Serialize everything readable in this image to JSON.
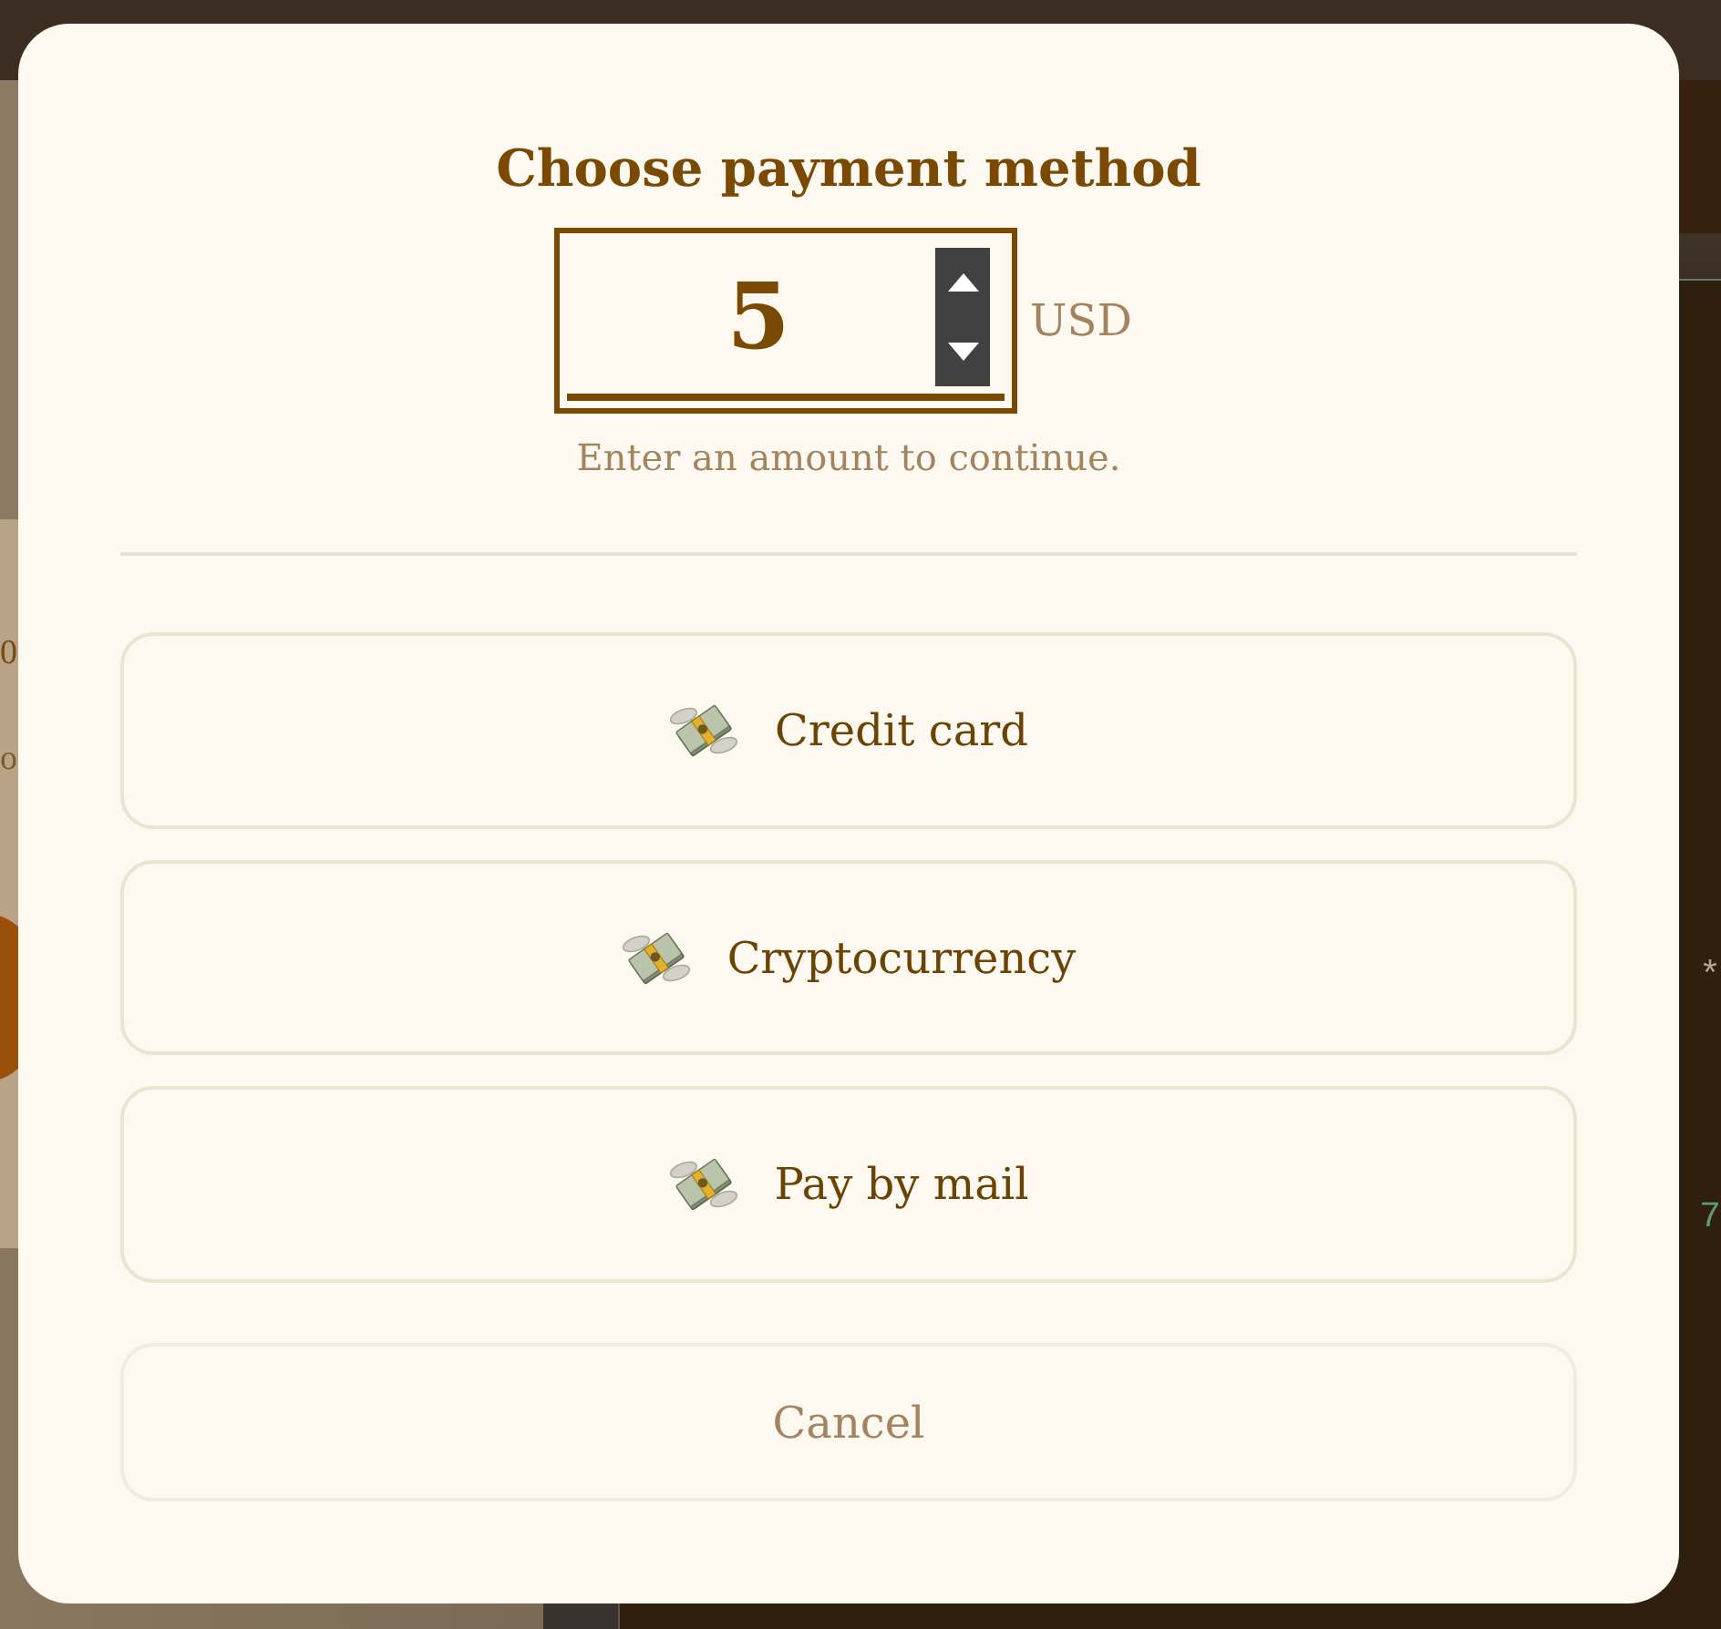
{
  "backdrop": {
    "left_panel": {
      "texts": [
        "0",
        "o"
      ]
    },
    "right_panel": {
      "texts": [
        "*",
        "7"
      ]
    }
  },
  "dialog": {
    "title": "Choose payment method",
    "amount": {
      "value": "5",
      "currency": "USD"
    },
    "hint": "Enter an amount to continue.",
    "methods": [
      {
        "label": "Credit card"
      },
      {
        "label": "Cryptocurrency"
      },
      {
        "label": "Pay by mail"
      }
    ],
    "cancel": "Cancel"
  }
}
